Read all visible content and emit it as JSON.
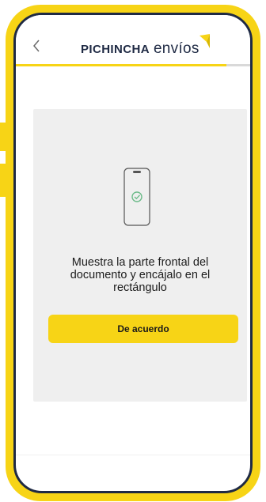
{
  "header": {
    "back_icon": "chevron-left-icon",
    "brand_main": "PICHINCHA",
    "brand_sub": "envíos"
  },
  "progress": {
    "fraction": 0.9
  },
  "card": {
    "illustration_icon": "phone-check-icon",
    "instruction": "Muestra la parte frontal del documento y encájalo en el rectángulo",
    "button_label": "De acuerdo"
  },
  "colors": {
    "accent": "#f7d416",
    "frame_inner": "#1f2a44",
    "check": "#6dbb8a",
    "card_bg": "#efefef"
  }
}
